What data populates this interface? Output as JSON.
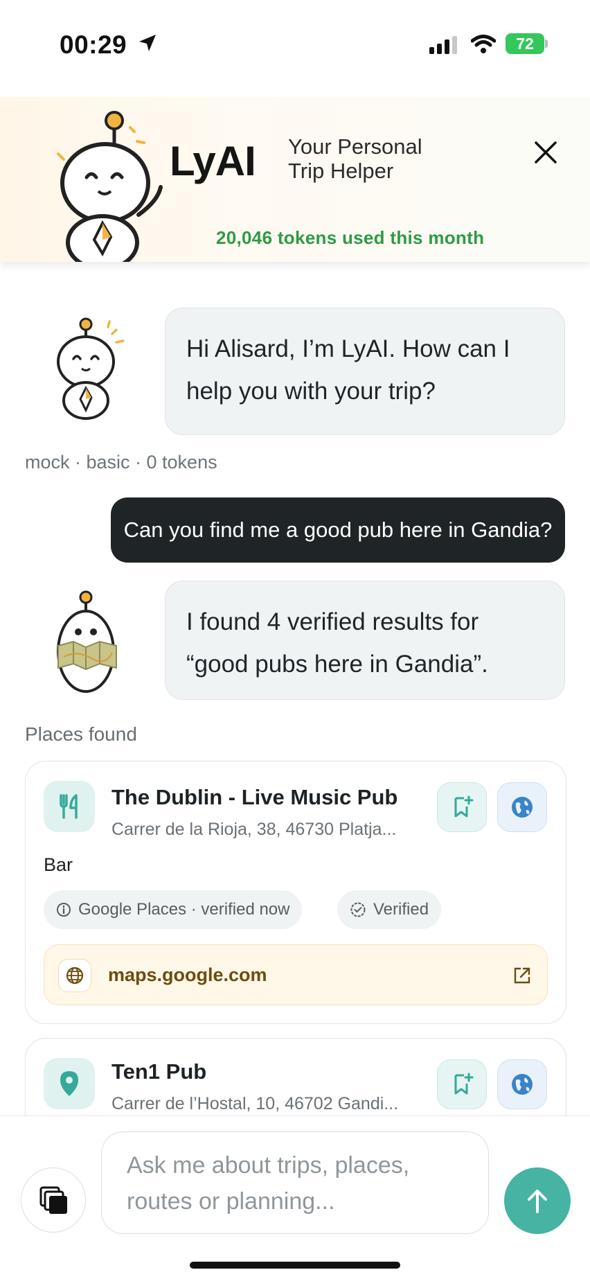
{
  "status_bar": {
    "time": "00:29",
    "battery": "72",
    "icons": [
      "location-arrow-icon",
      "cellular-signal-icon",
      "wifi-icon",
      "battery-charging-icon"
    ]
  },
  "header": {
    "brand": "LyAI",
    "tagline": "Your Personal Trip Helper",
    "tokens_used": "20,046 tokens used this month",
    "close_icon": "close-icon"
  },
  "chat": {
    "greeting": "Hi Alisard, I’m LyAI. How can I help you with your trip?",
    "meta": "mock · basic · 0 tokens",
    "user_message": "Can you find me a good pub here in Gandia?",
    "results_message": "I found 4 verified results for “good pubs here in Gandia”.",
    "places_label": "Places found"
  },
  "places": [
    {
      "name": "The Dublin - Live Music Pub",
      "address": "Carrer de la Rioja, 38, 46730 Platja...",
      "type": "Bar",
      "source_chip": "Google Places · verified now",
      "verified_chip": "Verified",
      "link": "maps.google.com",
      "icon": "utensils-icon"
    },
    {
      "name": "Ten1 Pub",
      "address": "Carrer de l’Hostal, 10, 46702 Gandi...",
      "icon": "map-pin-icon"
    }
  ],
  "composer": {
    "placeholder": "Ask me about trips, places, routes or planning..."
  },
  "colors": {
    "accent_teal": "#46b3a3",
    "tokens_green": "#2e9a45",
    "user_bubble": "#1f2427",
    "bot_bubble": "#f0f3f4"
  }
}
